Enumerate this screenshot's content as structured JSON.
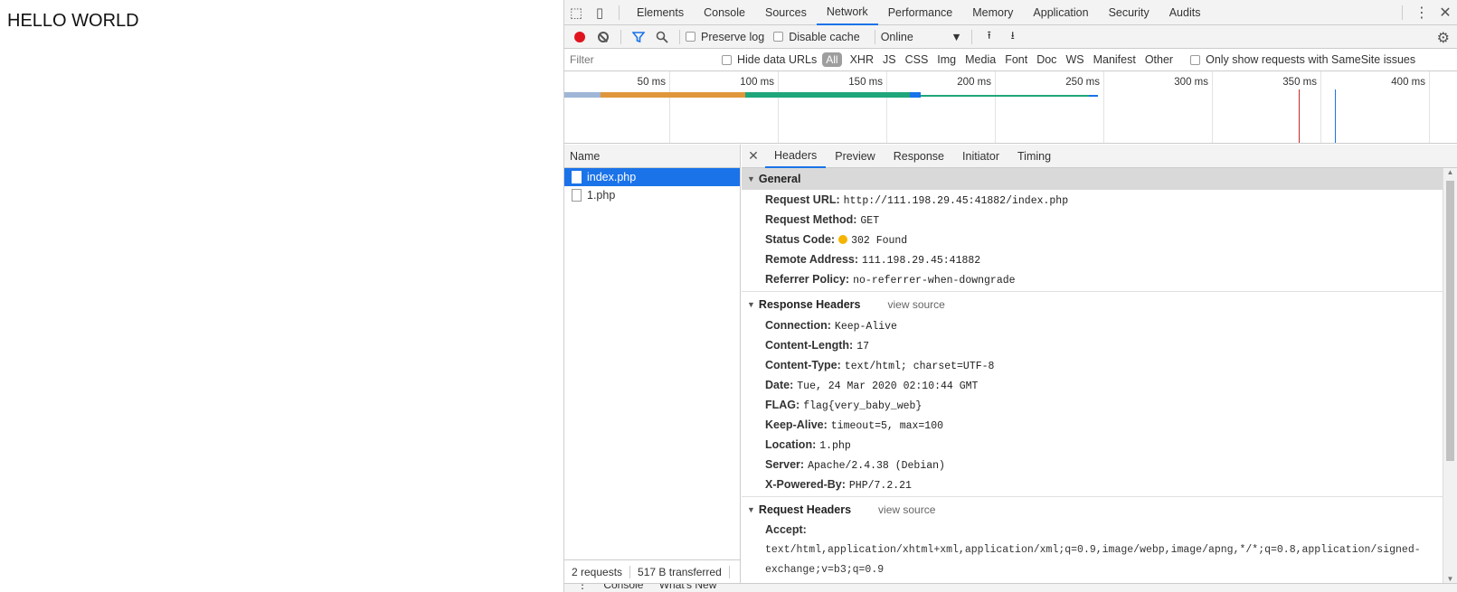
{
  "page": {
    "body_text": "HELLO WORLD"
  },
  "devtools": {
    "tabs": [
      "Elements",
      "Console",
      "Sources",
      "Network",
      "Performance",
      "Memory",
      "Application",
      "Security",
      "Audits"
    ],
    "active_tab": "Network",
    "toolbar": {
      "preserve_log": "Preserve log",
      "disable_cache": "Disable cache",
      "throttling": "Online"
    },
    "filter": {
      "placeholder": "Filter",
      "hide_data_urls": "Hide data URLs",
      "types": [
        "All",
        "XHR",
        "JS",
        "CSS",
        "Img",
        "Media",
        "Font",
        "Doc",
        "WS",
        "Manifest",
        "Other"
      ],
      "samesite": "Only show requests with SameSite issues"
    },
    "timeline": {
      "ticks": [
        "50 ms",
        "100 ms",
        "150 ms",
        "200 ms",
        "250 ms",
        "300 ms",
        "350 ms",
        "400 ms"
      ]
    },
    "requests": {
      "header": "Name",
      "items": [
        "index.php",
        "1.php"
      ],
      "selected": "index.php",
      "summary_count": "2 requests",
      "summary_size": "517 B transferred"
    },
    "detail_tabs": [
      "Headers",
      "Preview",
      "Response",
      "Initiator",
      "Timing"
    ],
    "active_detail_tab": "Headers",
    "general": {
      "title": "General",
      "rows": [
        {
          "key": "Request URL:",
          "value": "http://111.198.29.45:41882/index.php"
        },
        {
          "key": "Request Method:",
          "value": "GET"
        },
        {
          "key": "Status Code:",
          "value": "302 Found"
        },
        {
          "key": "Remote Address:",
          "value": "111.198.29.45:41882"
        },
        {
          "key": "Referrer Policy:",
          "value": "no-referrer-when-downgrade"
        }
      ]
    },
    "response_headers": {
      "title": "Response Headers",
      "view_source": "view source",
      "rows": [
        {
          "key": "Connection:",
          "value": "Keep-Alive"
        },
        {
          "key": "Content-Length:",
          "value": "17"
        },
        {
          "key": "Content-Type:",
          "value": "text/html; charset=UTF-8"
        },
        {
          "key": "Date:",
          "value": "Tue, 24 Mar 2020 02:10:44 GMT"
        },
        {
          "key": "FLAG:",
          "value": "flag{very_baby_web}"
        },
        {
          "key": "Keep-Alive:",
          "value": "timeout=5, max=100"
        },
        {
          "key": "Location:",
          "value": "1.php"
        },
        {
          "key": "Server:",
          "value": "Apache/2.4.38 (Debian)"
        },
        {
          "key": "X-Powered-By:",
          "value": "PHP/7.2.21"
        }
      ]
    },
    "request_headers": {
      "title": "Request Headers",
      "view_source": "view source",
      "accept_key": "Accept:",
      "accept_value_line1": "text/html,application/xhtml+xml,application/xml;q=0.9,image/webp,image/apng,*/*;q=0.8,application/signed-",
      "accept_value_line2": "exchange;v=b3;q=0.9"
    },
    "drawer": {
      "tabs": [
        "Console",
        "What's New"
      ]
    }
  }
}
